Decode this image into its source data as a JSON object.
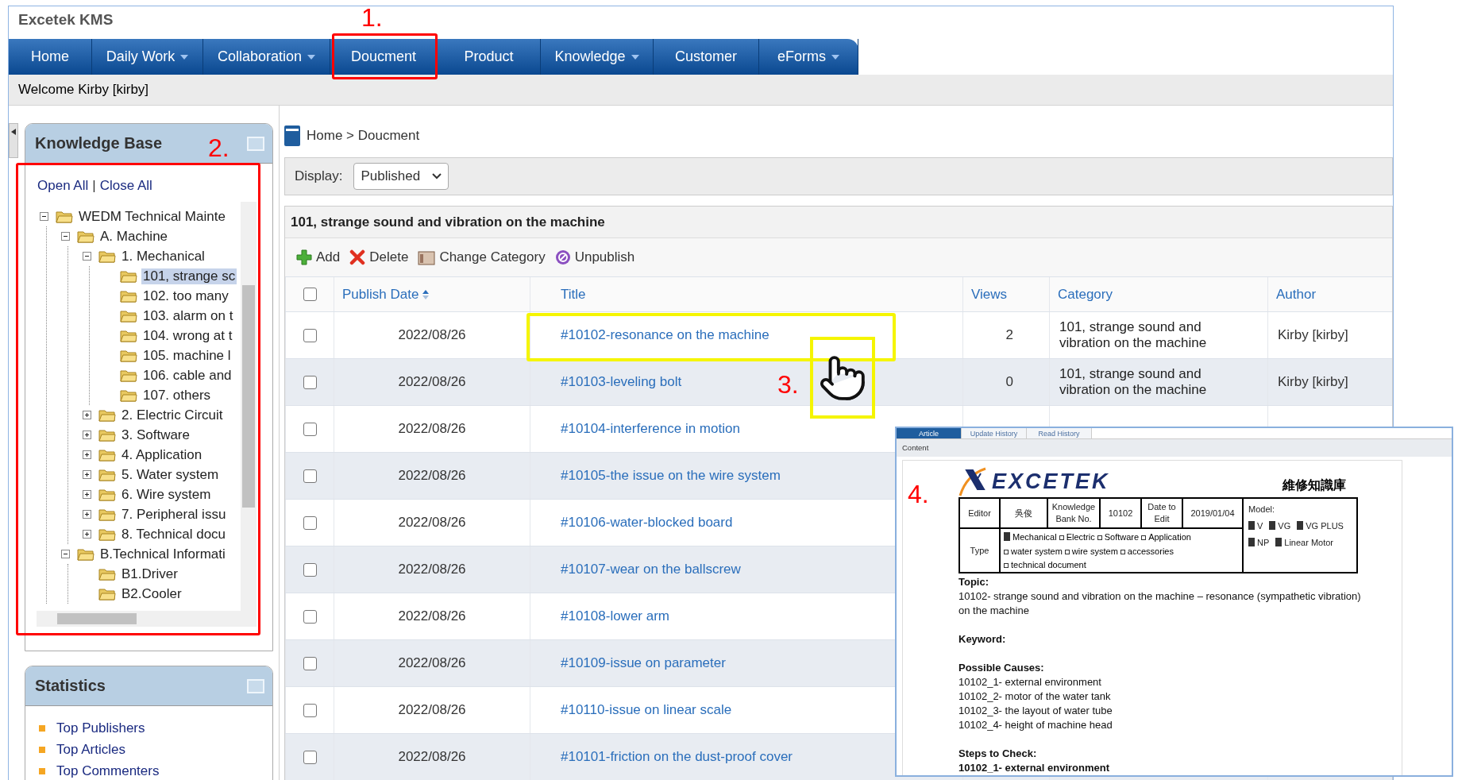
{
  "app": {
    "title": "Excetek KMS"
  },
  "nav": [
    {
      "label": "Home",
      "dropdown": false
    },
    {
      "label": "Daily Work",
      "dropdown": true
    },
    {
      "label": "Collaboration",
      "dropdown": true
    },
    {
      "label": "Doucment",
      "dropdown": false
    },
    {
      "label": "Product",
      "dropdown": false
    },
    {
      "label": "Knowledge",
      "dropdown": true
    },
    {
      "label": "Customer",
      "dropdown": false
    },
    {
      "label": "eForms",
      "dropdown": true
    }
  ],
  "welcome": "Welcome Kirby [kirby]",
  "sidebar": {
    "knowledge_base": {
      "title": "Knowledge Base",
      "links": [
        "Open All",
        "Close All"
      ],
      "separator": "|",
      "tree": [
        {
          "label": "WEDM Technical Mainte",
          "expanded": true,
          "selected": false,
          "children": [
            {
              "label": "A. Machine",
              "expanded": true,
              "selected": false,
              "children": [
                {
                  "label": "1. Mechanical",
                  "expanded": true,
                  "selected": false,
                  "children": [
                    {
                      "label": "101, strange sc",
                      "selected": true
                    },
                    {
                      "label": "102. too many",
                      "selected": false
                    },
                    {
                      "label": "103. alarm on t",
                      "selected": false
                    },
                    {
                      "label": "104. wrong at t",
                      "selected": false
                    },
                    {
                      "label": "105. machine l",
                      "selected": false
                    },
                    {
                      "label": "106. cable and",
                      "selected": false
                    },
                    {
                      "label": "107. others",
                      "selected": false
                    }
                  ]
                },
                {
                  "label": "2. Electric Circuit",
                  "expanded": false,
                  "selected": false
                },
                {
                  "label": "3. Software",
                  "expanded": false,
                  "selected": false
                },
                {
                  "label": "4. Application",
                  "expanded": false,
                  "selected": false
                },
                {
                  "label": "5. Water system",
                  "expanded": false,
                  "selected": false
                },
                {
                  "label": "6. Wire system",
                  "expanded": false,
                  "selected": false
                },
                {
                  "label": "7. Peripheral issu",
                  "expanded": false,
                  "selected": false
                },
                {
                  "label": "8. Technical docu",
                  "expanded": false,
                  "selected": false
                }
              ]
            },
            {
              "label": "B.Technical Informati",
              "expanded": true,
              "selected": false,
              "children": [
                {
                  "label": "B1.Driver",
                  "selected": false
                },
                {
                  "label": "B2.Cooler",
                  "selected": false
                }
              ]
            }
          ]
        }
      ]
    },
    "statistics": {
      "title": "Statistics",
      "items": [
        "Top Publishers",
        "Top Articles",
        "Top Commenters"
      ]
    }
  },
  "breadcrumb": "Home > Doucment",
  "display": {
    "label": "Display:",
    "value": "Published"
  },
  "category_title": "101, strange sound and vibration on the machine",
  "toolbar": [
    {
      "kind": "add",
      "label": "Add"
    },
    {
      "kind": "delete",
      "label": "Delete"
    },
    {
      "kind": "category",
      "label": "Change Category"
    },
    {
      "kind": "unpublish",
      "label": "Unpublish"
    }
  ],
  "table": {
    "select_all": {
      "checked": false
    },
    "columns": [
      {
        "label": "Publish Date",
        "sorted": true
      },
      {
        "label": "Title",
        "sorted": false
      },
      {
        "label": "Views",
        "sorted": false
      },
      {
        "label": "Category",
        "sorted": false
      },
      {
        "label": "Author",
        "sorted": false
      }
    ],
    "rows": [
      {
        "checked": false,
        "date": "2022/08/26",
        "title": "#10102-resonance on the machine",
        "views": "2",
        "category": "101, strange sound and vibration on the machine",
        "author": "Kirby [kirby]"
      },
      {
        "checked": false,
        "date": "2022/08/26",
        "title": "#10103-leveling bolt",
        "views": "0",
        "category": "101, strange sound and vibration on the machine",
        "author": "Kirby [kirby]"
      },
      {
        "checked": false,
        "date": "2022/08/26",
        "title": "#10104-interference in motion"
      },
      {
        "checked": false,
        "date": "2022/08/26",
        "title": "#10105-the issue on the wire system"
      },
      {
        "checked": false,
        "date": "2022/08/26",
        "title": "#10106-water-blocked board"
      },
      {
        "checked": false,
        "date": "2022/08/26",
        "title": "#10107-wear on the ballscrew"
      },
      {
        "checked": false,
        "date": "2022/08/26",
        "title": "#10108-lower arm"
      },
      {
        "checked": false,
        "date": "2022/08/26",
        "title": "#10109-issue on parameter"
      },
      {
        "checked": false,
        "date": "2022/08/26",
        "title": "#10110-issue on linear scale"
      },
      {
        "checked": false,
        "date": "2022/08/26",
        "title": "#10101-friction on the dust-proof cover"
      }
    ]
  },
  "article_preview": {
    "tabs": [
      {
        "label": "Article",
        "selected": true
      },
      {
        "label": "Update History",
        "selected": false
      },
      {
        "label": "Read History",
        "selected": false
      }
    ],
    "section_label": "Content",
    "document": {
      "brand": "EXCETEK",
      "heading": "維修知識庫",
      "info": {
        "editor_label": "Editor",
        "editor": "吳俊",
        "number_label": "Knowledge Bank No.",
        "number": "10102",
        "date_label": "Date to Edit",
        "date": "2019/01/04",
        "type_label": "Type",
        "model_label": "Model:",
        "types": [
          {
            "label": "Mechanical",
            "checked": true
          },
          {
            "label": "Electric",
            "checked": false
          },
          {
            "label": "Software",
            "checked": false
          },
          {
            "label": "Application",
            "checked": false
          },
          {
            "label": "water system",
            "checked": false
          },
          {
            "label": "wire system",
            "checked": false
          },
          {
            "label": "accessories",
            "checked": false
          },
          {
            "label": "technical document",
            "checked": false
          }
        ],
        "models": [
          {
            "label": "V",
            "checked": true
          },
          {
            "label": "VG",
            "checked": true
          },
          {
            "label": "VG PLUS",
            "checked": true
          },
          {
            "label": "NP",
            "checked": true
          },
          {
            "label": "Linear Motor",
            "checked": true
          }
        ]
      },
      "sections": [
        {
          "heading": "Topic:",
          "lines": [
            "10102- strange sound and vibration on the machine – resonance (sympathetic vibration) on the machine"
          ]
        },
        {
          "heading": "Keyword:"
        },
        {
          "heading": "Possible Causes:",
          "lines": [
            "10102_1- external environment",
            "10102_2- motor of the water tank",
            "10102_3- the layout of water tube",
            "10102_4- height of machine head"
          ]
        },
        {
          "heading": "Steps to Check:",
          "subheading": "10102_1- external environment"
        }
      ]
    }
  },
  "annotations": {
    "nav": "1.",
    "tree": "2.",
    "row": "3.",
    "preview": "4."
  }
}
